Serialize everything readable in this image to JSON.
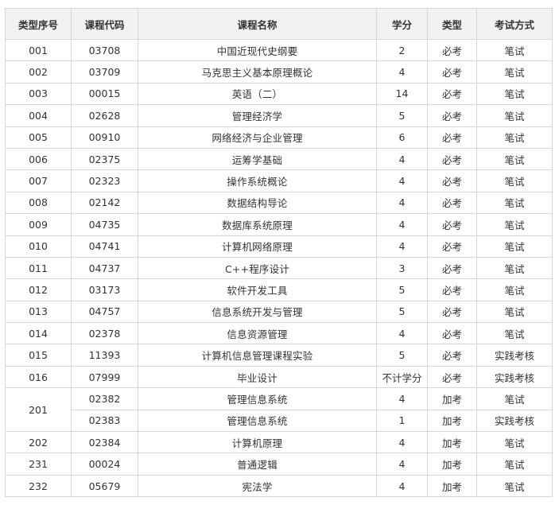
{
  "headers": [
    "类型序号",
    "课程代码",
    "课程名称",
    "学分",
    "类型",
    "考试方式"
  ],
  "rows": [
    {
      "seq": "001",
      "code": "03708",
      "name": "中国近现代史纲要",
      "credit": "2",
      "type": "必考",
      "exam": "笔试"
    },
    {
      "seq": "002",
      "code": "03709",
      "name": "马克思主义基本原理概论",
      "credit": "4",
      "type": "必考",
      "exam": "笔试"
    },
    {
      "seq": "003",
      "code": "00015",
      "name": "英语（二）",
      "credit": "14",
      "type": "必考",
      "exam": "笔试"
    },
    {
      "seq": "004",
      "code": "02628",
      "name": "管理经济学",
      "credit": "5",
      "type": "必考",
      "exam": "笔试"
    },
    {
      "seq": "005",
      "code": "00910",
      "name": "网络经济与企业管理",
      "credit": "6",
      "type": "必考",
      "exam": "笔试"
    },
    {
      "seq": "006",
      "code": "02375",
      "name": "运筹学基础",
      "credit": "4",
      "type": "必考",
      "exam": "笔试"
    },
    {
      "seq": "007",
      "code": "02323",
      "name": "操作系统概论",
      "credit": "4",
      "type": "必考",
      "exam": "笔试"
    },
    {
      "seq": "008",
      "code": "02142",
      "name": "数据结构导论",
      "credit": "4",
      "type": "必考",
      "exam": "笔试"
    },
    {
      "seq": "009",
      "code": "04735",
      "name": "数据库系统原理",
      "credit": "4",
      "type": "必考",
      "exam": "笔试"
    },
    {
      "seq": "010",
      "code": "04741",
      "name": "计算机网络原理",
      "credit": "4",
      "type": "必考",
      "exam": "笔试"
    },
    {
      "seq": "011",
      "code": "04737",
      "name": "C++程序设计",
      "credit": "3",
      "type": "必考",
      "exam": "笔试"
    },
    {
      "seq": "012",
      "code": "03173",
      "name": "软件开发工具",
      "credit": "5",
      "type": "必考",
      "exam": "笔试"
    },
    {
      "seq": "013",
      "code": "04757",
      "name": "信息系统开发与管理",
      "credit": "5",
      "type": "必考",
      "exam": "笔试"
    },
    {
      "seq": "014",
      "code": "02378",
      "name": "信息资源管理",
      "credit": "4",
      "type": "必考",
      "exam": "笔试"
    },
    {
      "seq": "015",
      "code": "11393",
      "name": "计算机信息管理课程实验",
      "credit": "5",
      "type": "必考",
      "exam": "实践考核"
    },
    {
      "seq": "016",
      "code": "07999",
      "name": "毕业设计",
      "credit": "不计学分",
      "type": "必考",
      "exam": "实践考核"
    },
    {
      "seq": "201",
      "code": "02382",
      "name": "管理信息系统",
      "credit": "4",
      "type": "加考",
      "exam": "笔试"
    },
    {
      "seq": "",
      "code": "02383",
      "name": "管理信息系统",
      "credit": "1",
      "type": "加考",
      "exam": "实践考核"
    },
    {
      "seq": "202",
      "code": "02384",
      "name": "计算机原理",
      "credit": "4",
      "type": "加考",
      "exam": "笔试"
    },
    {
      "seq": "231",
      "code": "00024",
      "name": "普通逻辑",
      "credit": "4",
      "type": "加考",
      "exam": "笔试"
    },
    {
      "seq": "232",
      "code": "05679",
      "name": "宪法学",
      "credit": "4",
      "type": "加考",
      "exam": "笔试"
    }
  ]
}
